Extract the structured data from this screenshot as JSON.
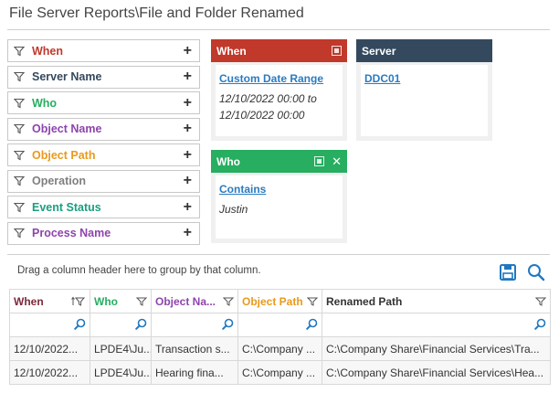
{
  "page": {
    "title": "File Server Reports\\File and Folder Renamed"
  },
  "colors": {
    "when": "#c0392b",
    "server_name": "#34495e",
    "who": "#27ae60",
    "object_name": "#8e44ad",
    "object_path": "#e89a1c",
    "operation": "#7f7f7f",
    "event_status": "#1a9e80",
    "process_name": "#8e44ad",
    "link": "#2a7bc0",
    "icon_blue": "#1f78c1"
  },
  "filters": [
    {
      "label": "When",
      "color": "#c0392b"
    },
    {
      "label": "Server Name",
      "color": "#34495e"
    },
    {
      "label": "Who",
      "color": "#27ae60"
    },
    {
      "label": "Object Name",
      "color": "#8e44ad"
    },
    {
      "label": "Object Path",
      "color": "#e89a1c"
    },
    {
      "label": "Operation",
      "color": "#7f7f7f"
    },
    {
      "label": "Event Status",
      "color": "#1a9e80"
    },
    {
      "label": "Process Name",
      "color": "#8e44ad"
    }
  ],
  "filter_add_glyph": "+",
  "cards": {
    "when": {
      "title": "When",
      "link": "Custom Date Range",
      "value_line1": "12/10/2022 00:00 to",
      "value_line2": "12/10/2022 00:00"
    },
    "server": {
      "title": "Server",
      "link": "DDC01"
    },
    "who": {
      "title": "Who",
      "link": "Contains",
      "value": "Justin",
      "close_glyph": "✕"
    }
  },
  "grid": {
    "group_hint": "Drag a column header here to group by that column.",
    "columns": [
      {
        "label": "When",
        "color": "#7b2a3a"
      },
      {
        "label": "Who",
        "color": "#27ae60"
      },
      {
        "label": "Object Na...",
        "color": "#8e44ad"
      },
      {
        "label": "Object Path",
        "color": "#e89a1c"
      },
      {
        "label": "Renamed Path",
        "color": "#333333"
      }
    ],
    "rows": [
      [
        "12/10/2022...",
        "LPDE4\\Ju...",
        "Transaction s...",
        "C:\\Company ...",
        "C:\\Company Share\\Financial Services\\Tra..."
      ],
      [
        "12/10/2022...",
        "LPDE4\\Ju...",
        "Hearing fina...",
        "C:\\Company ...",
        "C:\\Company Share\\Financial Services\\Hea..."
      ]
    ]
  }
}
